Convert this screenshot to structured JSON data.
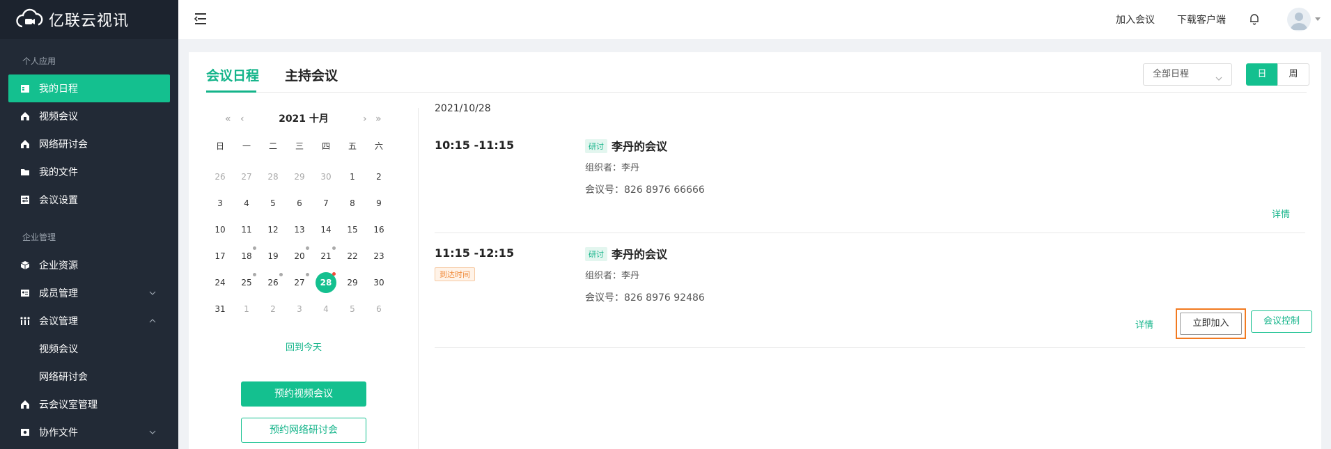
{
  "app": {
    "title": "亿联云视讯"
  },
  "sidebar": {
    "section_personal": "个人应用",
    "section_enterprise": "企业管理",
    "items": [
      {
        "label": "我的日程",
        "icon": "calendar-icon"
      },
      {
        "label": "视频会议",
        "icon": "home-icon"
      },
      {
        "label": "网络研讨会",
        "icon": "home-icon"
      },
      {
        "label": "我的文件",
        "icon": "folder-icon"
      },
      {
        "label": "会议设置",
        "icon": "settings-icon"
      },
      {
        "label": "企业资源",
        "icon": "cube-icon"
      },
      {
        "label": "成员管理",
        "icon": "id-card-icon"
      },
      {
        "label": "会议管理",
        "icon": "people-icon"
      },
      {
        "label": "视频会议",
        "icon": ""
      },
      {
        "label": "网络研讨会",
        "icon": ""
      },
      {
        "label": "云会议室管理",
        "icon": "home-icon"
      },
      {
        "label": "协作文件",
        "icon": "file-icon"
      }
    ]
  },
  "topbar": {
    "join_meeting": "加入会议",
    "download_client": "下载客户端"
  },
  "tabs": {
    "schedule": "会议日程",
    "host": "主持会议"
  },
  "filter": {
    "selected": "全部日程"
  },
  "view_toggle": {
    "day": "日",
    "week": "周"
  },
  "calendar": {
    "title": "2021 十月",
    "weekdays": [
      "日",
      "一",
      "二",
      "三",
      "四",
      "五",
      "六"
    ],
    "weeks": [
      [
        {
          "d": "26",
          "m": true
        },
        {
          "d": "27",
          "m": true
        },
        {
          "d": "28",
          "m": true
        },
        {
          "d": "29",
          "m": true
        },
        {
          "d": "30",
          "m": true
        },
        {
          "d": "1"
        },
        {
          "d": "2"
        }
      ],
      [
        {
          "d": "3"
        },
        {
          "d": "4"
        },
        {
          "d": "5"
        },
        {
          "d": "6"
        },
        {
          "d": "7"
        },
        {
          "d": "8"
        },
        {
          "d": "9"
        }
      ],
      [
        {
          "d": "10"
        },
        {
          "d": "11"
        },
        {
          "d": "12"
        },
        {
          "d": "13"
        },
        {
          "d": "14"
        },
        {
          "d": "15"
        },
        {
          "d": "16"
        }
      ],
      [
        {
          "d": "17"
        },
        {
          "d": "18",
          "dot": "grey"
        },
        {
          "d": "19"
        },
        {
          "d": "20",
          "dot": "grey"
        },
        {
          "d": "21",
          "dot": "grey"
        },
        {
          "d": "22"
        },
        {
          "d": "23"
        }
      ],
      [
        {
          "d": "24"
        },
        {
          "d": "25",
          "dot": "grey"
        },
        {
          "d": "26",
          "dot": "grey"
        },
        {
          "d": "27",
          "dot": "grey"
        },
        {
          "d": "28",
          "today": true,
          "dot": "red"
        },
        {
          "d": "29"
        },
        {
          "d": "30"
        }
      ],
      [
        {
          "d": "31"
        },
        {
          "d": "1",
          "m": true
        },
        {
          "d": "2",
          "m": true
        },
        {
          "d": "3",
          "m": true
        },
        {
          "d": "4",
          "m": true
        },
        {
          "d": "5",
          "m": true
        },
        {
          "d": "6",
          "m": true
        }
      ]
    ],
    "back_today": "回到今天"
  },
  "actions": {
    "book_video": "预约视频会议",
    "book_webinar": "预约网络研讨会"
  },
  "schedule": {
    "date": "2021/10/28",
    "meetings": [
      {
        "time": "10:15 -11:15",
        "tag": "研讨",
        "title": "李丹的会议",
        "organizer": "组织者：李丹",
        "number": "会议号：826 8976 66666",
        "detail": "详情"
      },
      {
        "time": "11:15 -12:15",
        "status": "到达时间",
        "tag": "研讨",
        "title": "李丹的会议",
        "organizer": "组织者：李丹",
        "number": "会议号：826 8976 92486",
        "detail": "详情",
        "join": "立即加入",
        "control": "会议控制"
      }
    ]
  },
  "colors": {
    "accent": "#14c08f",
    "sidebar_bg": "#222a36",
    "highlight": "#f27a20"
  }
}
